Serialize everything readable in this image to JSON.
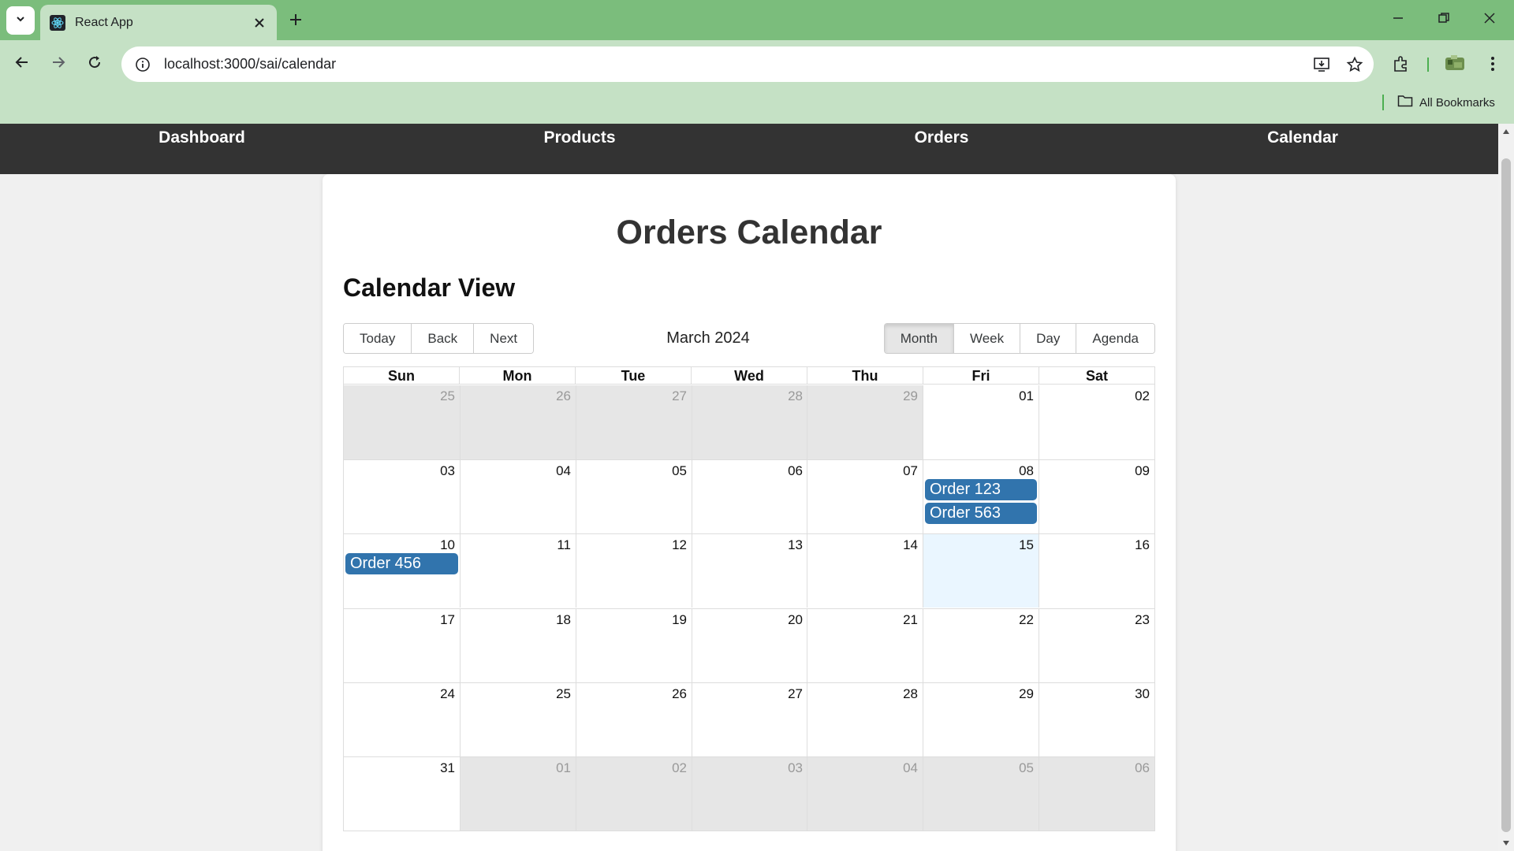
{
  "browser": {
    "tab_title": "React App",
    "url": "localhost:3000/sai/calendar",
    "bookmarks_label": "All Bookmarks",
    "theme_color": "#7bbd7c",
    "toolbar_color": "#c5e1c5"
  },
  "app_nav": {
    "items": [
      "Dashboard",
      "Products",
      "Orders",
      "Calendar"
    ]
  },
  "page": {
    "title": "Orders Calendar",
    "section_title": "Calendar View"
  },
  "calendar": {
    "label": "March 2024",
    "nav_buttons": [
      "Today",
      "Back",
      "Next"
    ],
    "view_buttons": [
      "Month",
      "Week",
      "Day",
      "Agenda"
    ],
    "active_view": "Month",
    "weekdays": [
      "Sun",
      "Mon",
      "Tue",
      "Wed",
      "Thu",
      "Fri",
      "Sat"
    ],
    "weeks": [
      [
        "25",
        "26",
        "27",
        "28",
        "29",
        "01",
        "02"
      ],
      [
        "03",
        "04",
        "05",
        "06",
        "07",
        "08",
        "09"
      ],
      [
        "10",
        "11",
        "12",
        "13",
        "14",
        "15",
        "16"
      ],
      [
        "17",
        "18",
        "19",
        "20",
        "21",
        "22",
        "23"
      ],
      [
        "24",
        "25",
        "26",
        "27",
        "28",
        "29",
        "30"
      ],
      [
        "31",
        "01",
        "02",
        "03",
        "04",
        "05",
        "06"
      ]
    ],
    "today": "15",
    "events": [
      {
        "title": "Order 123",
        "date": "2024-03-08"
      },
      {
        "title": "Order 563",
        "date": "2024-03-08"
      },
      {
        "title": "Order 456",
        "date": "2024-03-10"
      }
    ],
    "event_color": "#3174ad",
    "today_color": "#eaf6ff",
    "off_range_color": "#e6e6e6"
  }
}
